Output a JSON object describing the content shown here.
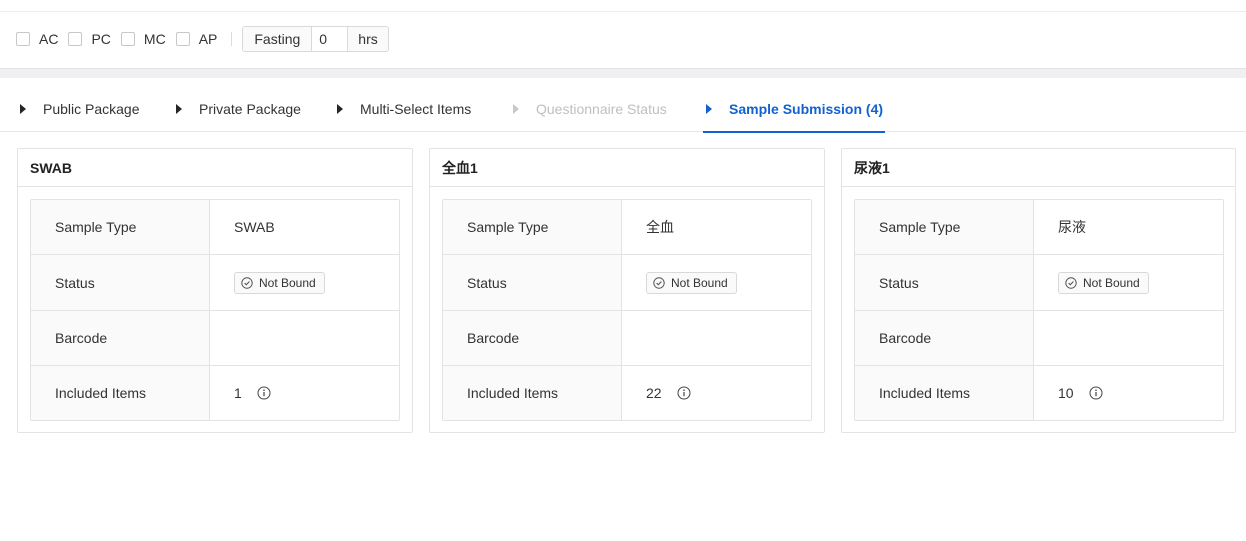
{
  "filters": {
    "checkboxes": [
      "AC",
      "PC",
      "MC",
      "AP"
    ],
    "fasting_label": "Fasting",
    "fasting_value": "0",
    "fasting_unit": "hrs"
  },
  "tabs": [
    {
      "label": "Public Package",
      "state": "normal"
    },
    {
      "label": "Private Package",
      "state": "normal"
    },
    {
      "label": "Multi-Select Items",
      "state": "normal"
    },
    {
      "label": "Questionnaire Status",
      "state": "disabled"
    },
    {
      "label": "Sample Submission (4)",
      "state": "active"
    }
  ],
  "row_labels": {
    "sample_type": "Sample Type",
    "status": "Status",
    "barcode": "Barcode",
    "included_items": "Included Items"
  },
  "cards": [
    {
      "title": "SWAB",
      "sample_type": "SWAB",
      "status": "Not Bound",
      "barcode": "",
      "included_items": "1"
    },
    {
      "title": "全血1",
      "sample_type": "全血",
      "status": "Not Bound",
      "barcode": "",
      "included_items": "22"
    },
    {
      "title": "尿液1",
      "sample_type": "尿液",
      "status": "Not Bound",
      "barcode": "",
      "included_items": "10"
    }
  ],
  "colors": {
    "accent": "#1261d2",
    "disabled": "#bfbfbf",
    "label_bg": "#fafafa",
    "border": "#e3e3e3"
  }
}
